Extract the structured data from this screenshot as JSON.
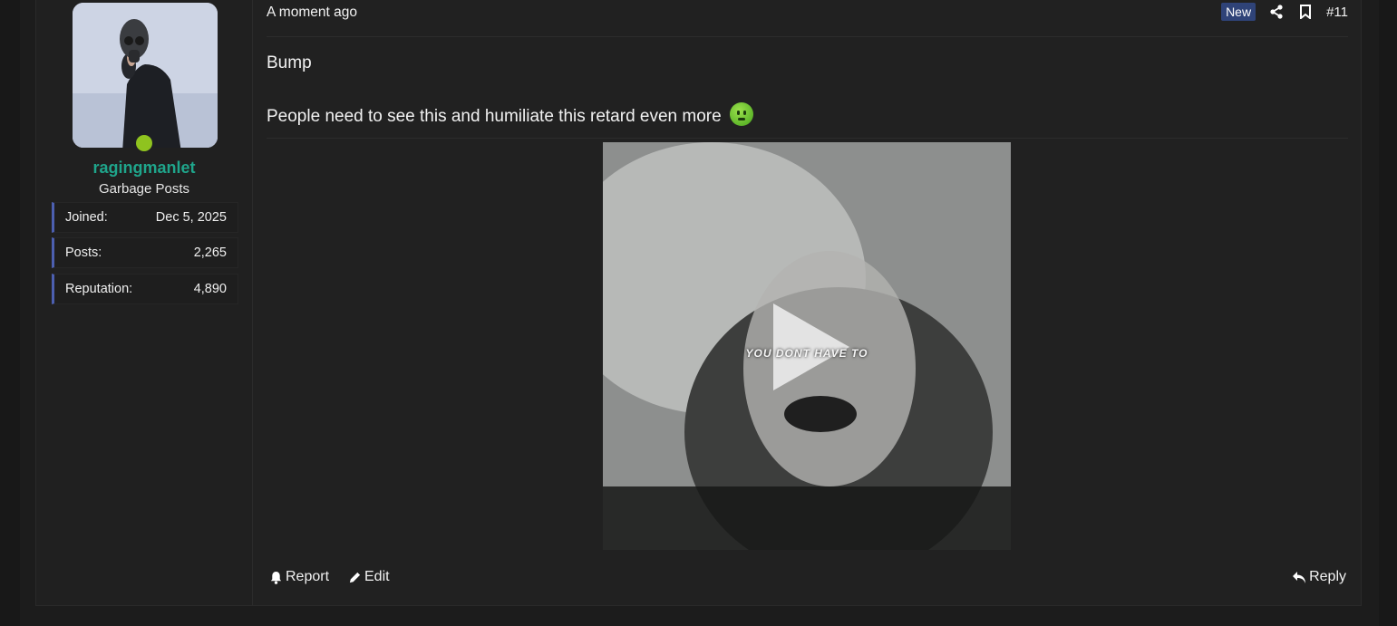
{
  "user": {
    "username": "ragingmanlet",
    "user_title": "Garbage Posts",
    "online_status_color": "#8fc31f",
    "stats": [
      {
        "label": "Joined:",
        "value": "Dec 5, 2025"
      },
      {
        "label": "Posts:",
        "value": "2,265"
      },
      {
        "label": "Reputation:",
        "value": "4,890"
      }
    ]
  },
  "post": {
    "timestamp": "A moment ago",
    "new_badge": "New",
    "post_number": "#11",
    "line1": "Bump",
    "line2": "People need to see this and humiliate this retard even more",
    "emoji_icon": "nauseated-face-icon",
    "video": {
      "caption": "YOU DONT HAVE TO",
      "play_icon": "play-icon"
    }
  },
  "actions": {
    "report_label": "Report",
    "edit_label": "Edit",
    "reply_label": "Reply"
  },
  "colors": {
    "username": "#1fa58b",
    "stat_accent": "#4c5fb0",
    "new_badge": "#2f4378"
  }
}
